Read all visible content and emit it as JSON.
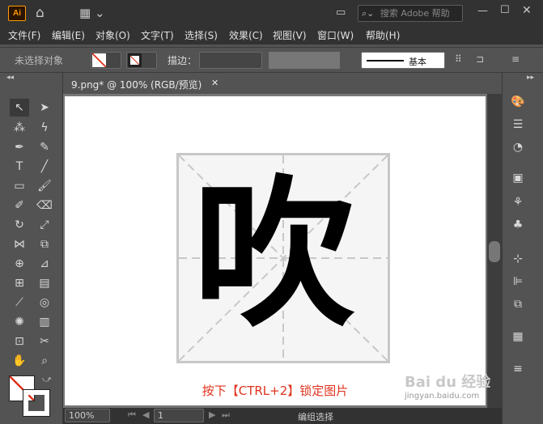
{
  "app": {
    "logo": "Ai",
    "search_placeholder": "搜索 Adobe 帮助"
  },
  "menu": [
    "文件(F)",
    "编辑(E)",
    "对象(O)",
    "文字(T)",
    "选择(S)",
    "效果(C)",
    "视图(V)",
    "窗口(W)",
    "帮助(H)"
  ],
  "control": {
    "selection": "未选择对象",
    "stroke_label": "描边：",
    "brush": "基本"
  },
  "document": {
    "tab_title": "9.png* @ 100% (RGB/预览)",
    "close": "✕"
  },
  "artwork": {
    "character": "吹",
    "caption": "按下【CTRL+2】锁定图片"
  },
  "status": {
    "zoom": "100%",
    "page": "1",
    "mode": "编组选择"
  },
  "watermark": {
    "brand": "Bai du 经验",
    "url": "jingyan.baidu.com"
  },
  "colors": {
    "accent": "#e0331e",
    "logo": "#ff9a00"
  }
}
